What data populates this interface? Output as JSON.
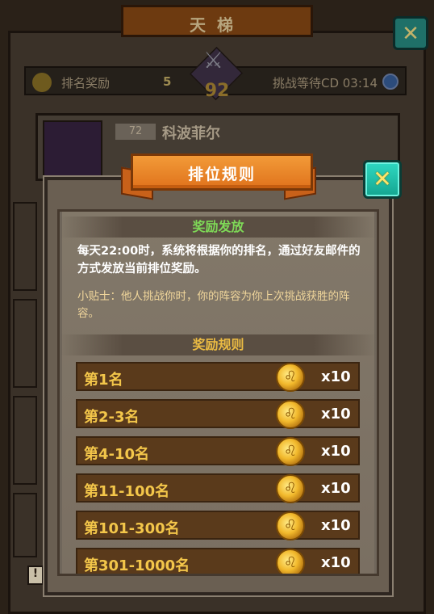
{
  "background": {
    "title": "天梯",
    "info_bar": {
      "reward_label": "排名奖励",
      "reward_value": "5",
      "cooldown_text": "挑战等待CD 03:14"
    },
    "my_rank": "92",
    "opponent": {
      "level": "72",
      "name": "科波菲尔"
    },
    "warning_glyph": "!"
  },
  "modal": {
    "title": "排位规则",
    "close_glyph": "✕",
    "section_distribution": "奖励发放",
    "description": "每天22:00时，系统将根据你的排名，通过好友邮件的方式发放当前排位奖励。",
    "tip": "小贴士：他人挑战你时，你的阵容为你上次挑战获胜的阵容。",
    "section_rules": "奖励规则",
    "rewards": [
      {
        "rank": "第1名",
        "qty": "x10",
        "icon": "lion-coin-icon"
      },
      {
        "rank": "第2-3名",
        "qty": "x10",
        "icon": "lion-coin-icon"
      },
      {
        "rank": "第4-10名",
        "qty": "x10",
        "icon": "lion-coin-icon"
      },
      {
        "rank": "第11-100名",
        "qty": "x10",
        "icon": "lion-coin-icon"
      },
      {
        "rank": "第101-300名",
        "qty": "x10",
        "icon": "lion-coin-icon"
      },
      {
        "rank": "第301-1000名",
        "qty": "x10",
        "icon": "lion-coin-icon"
      }
    ]
  },
  "colors": {
    "ribbon": "#e0731c",
    "close_button": "#14a590",
    "section_green": "#7ed957",
    "section_gold": "#ebbb43",
    "reward_row": "#5a3a1b"
  }
}
